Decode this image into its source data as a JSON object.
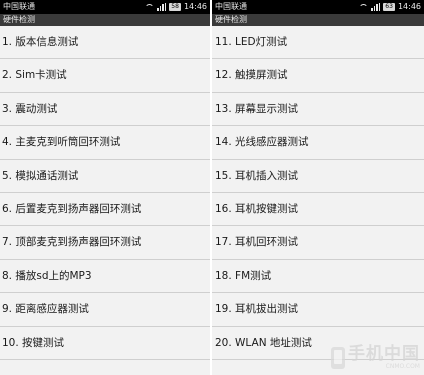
{
  "left_screen": {
    "status_bar": {
      "carrier": "中国联通",
      "battery": "58",
      "time": "14:46"
    },
    "title": "硬件检测",
    "items": [
      "1. 版本信息测试",
      "2. Sim卡测试",
      "3. 震动测试",
      "4. 主麦克到听筒回环测试",
      "5. 模拟通话测试",
      "6. 后置麦克到扬声器回环测试",
      "7. 顶部麦克到扬声器回环测试",
      "8. 播放sd上的MP3",
      "9. 距离感应器测试",
      "10. 按键测试"
    ]
  },
  "right_screen": {
    "status_bar": {
      "carrier": "中国联通",
      "battery": "63",
      "time": "14:46"
    },
    "title": "硬件检测",
    "items": [
      "11. LED灯测试",
      "12. 触摸屏测试",
      "13. 屏幕显示测试",
      "14. 光线感应器测试",
      "15. 耳机插入测试",
      "16. 耳机按键测试",
      "17. 耳机回环测试",
      "18. FM测试",
      "19. 耳机拔出测试",
      "20. WLAN 地址测试"
    ]
  },
  "watermark": {
    "main": "手机中国",
    "sub": "CNMO.COM"
  },
  "icons": [
    "wifi-icon",
    "signal-icon",
    "battery-icon"
  ]
}
